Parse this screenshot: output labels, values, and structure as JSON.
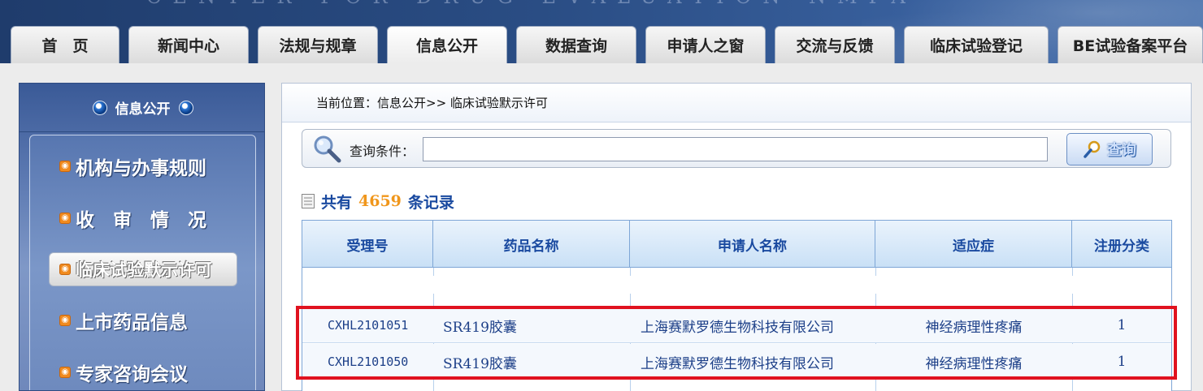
{
  "nav": {
    "tabs": [
      {
        "label": "首　页"
      },
      {
        "label": "新闻中心"
      },
      {
        "label": "法规与规章"
      },
      {
        "label": "信息公开",
        "active": true
      },
      {
        "label": "数据查询"
      },
      {
        "label": "申请人之窗"
      },
      {
        "label": "交流与反馈"
      },
      {
        "label": "临床试验登记"
      },
      {
        "label": "BE试验备案平台"
      }
    ]
  },
  "sidebar": {
    "title": "信息公开",
    "items": [
      {
        "label": "机构与办事规则"
      },
      {
        "label": "收　审　情　况"
      },
      {
        "label": "临床试验默示许可",
        "active": true
      },
      {
        "label": "上市药品信息"
      },
      {
        "label": "专家咨询会议"
      }
    ]
  },
  "main": {
    "breadcrumb": "当前位置：信息公开>> 临床试验默示许可",
    "search": {
      "label": "查询条件：",
      "value": "",
      "button_label": "查询"
    },
    "count": {
      "prefix": "共有",
      "number": "4659",
      "suffix": "条记录"
    },
    "table": {
      "columns": [
        "受理号",
        "药品名称",
        "申请人名称",
        "适应症",
        "注册分类"
      ],
      "rows": [
        [
          "CXHL2101051",
          "SR419胶囊",
          "上海赛默罗德生物科技有限公司",
          "神经病理性疼痛",
          "1"
        ],
        [
          "CXHL2101050",
          "SR419胶囊",
          "上海赛默罗德生物科技有限公司",
          "神经病理性疼痛",
          "1"
        ]
      ]
    }
  },
  "colors": {
    "header_blue": "#2a4d84",
    "table_header_text": "#1a4aa0",
    "count_number": "#f0961b",
    "highlight_red": "#e0121f"
  }
}
